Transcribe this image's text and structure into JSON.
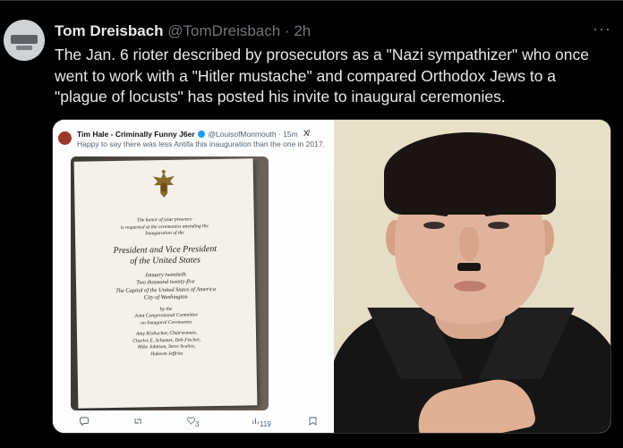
{
  "tweet": {
    "author_name": "Tom Dreisbach",
    "author_handle": "@TomDreisbach",
    "separator": "·",
    "time": "2h",
    "more_icon": "more-icon",
    "text": "The Jan. 6 rioter described by prosecutors as a \"Nazi sympathizer\" who once went to work with a \"Hitler mustache\" and compared Orthodox Jews to a \"plague of locusts\" has posted his invite to inaugural ceremonies."
  },
  "embedded": {
    "author_name": "Tim Hale - Criminally Funny J6er",
    "author_handle": "@LouisofMonmouth",
    "separator": "·",
    "time": "15m",
    "grok_label": "X̸",
    "text": "Happy to say there was less Antifa this inauguration than the one in 2017.",
    "actions": {
      "reply_icon": "reply-icon",
      "retweet_icon": "retweet-icon",
      "like_count": "3",
      "views_count": "119",
      "bookmark_icon": "bookmark-icon"
    }
  },
  "invitation": {
    "line1": "The honor of your presence",
    "line2": "is requested at the ceremonies attending the",
    "line3": "Inauguration of the",
    "title1": "President and Vice President",
    "title2": "of the United States",
    "date1": "January twentieth",
    "date2": "Two thousand twenty-five",
    "place1": "The Capitol of the United States of America",
    "place2": "City of Washington",
    "by1": "by the",
    "by2": "Joint Congressional Committee",
    "by3": "on Inaugural Ceremonies",
    "names1": "Amy Klobuchar, Chairwoman,",
    "names2": "Charles E. Schumer, Deb Fischer,",
    "names3": "Mike Johnson, Steve Scalise,",
    "names4": "Hakeem Jeffries"
  },
  "colors": {
    "background": "#000000",
    "text_primary": "#e7e9ea",
    "text_secondary": "#71767b",
    "verified": "#1d9bf0"
  }
}
